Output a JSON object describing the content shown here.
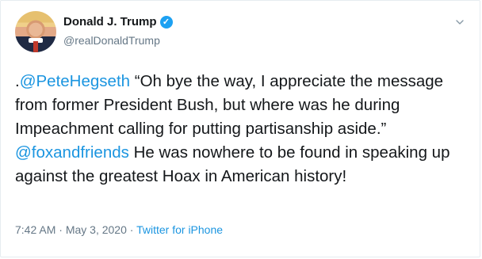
{
  "user": {
    "display_name": "Donald J. Trump",
    "handle": "@realDonaldTrump",
    "verified_mark": "✓"
  },
  "tweet": {
    "lead": ".",
    "mention1": "@PeteHegseth",
    "text1": "  “Oh bye the way, I appreciate the message from former President Bush, but where was he during Impeachment calling for putting partisanship aside.” ",
    "mention2": "@foxandfriends",
    "text2": "  He was nowhere to be found in speaking up against the greatest Hoax in American history!"
  },
  "meta": {
    "time": "7:42 AM",
    "sep1": " · ",
    "date": "May 3, 2020",
    "sep2": " · ",
    "source": "Twitter for iPhone"
  },
  "icons": {
    "verified": "verified-badge-icon",
    "menu": "chevron-down-icon"
  },
  "colors": {
    "link": "#1b95e0",
    "verified": "#1da1f2",
    "secondary_text": "#657786"
  }
}
